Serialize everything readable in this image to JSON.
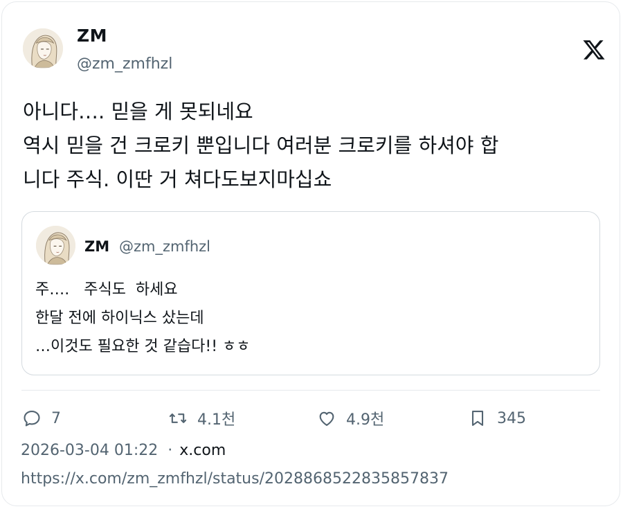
{
  "author": {
    "display_name": "ZM",
    "handle": "@zm_zmfhzl"
  },
  "tweet": {
    "lines": [
      "아니다…. 믿을 게 못되네요",
      "역시 믿을 건 크로키 뿐입니다 여러분 크로키를 하셔야 합",
      "니다 주식. 이딴 거 쳐다도보지마십쇼"
    ]
  },
  "quoted_tweet": {
    "display_name": "ZM",
    "handle": "@zm_zmfhzl",
    "lines": [
      "주….   주식도  하세요",
      "한달 전에 하이닉스 샀는데",
      "…이것도 필요한 것 같습다!! ㅎㅎ"
    ]
  },
  "actions": {
    "replies": "7",
    "reposts": "4.1천",
    "likes": "4.9천",
    "bookmarks": "345"
  },
  "meta": {
    "timestamp": "2026-03-04 01:22",
    "separator": "·",
    "source": "x.com",
    "url": "https://x.com/zm_zmfhzl/status/2028868522835857837"
  },
  "icons": {
    "brand": "x-logo-icon",
    "reply": "reply-bubble-icon",
    "repost": "repost-icon",
    "like": "heart-icon",
    "bookmark": "bookmark-icon"
  },
  "colors": {
    "text_primary": "#0f1419",
    "text_secondary": "#536471",
    "border": "#e6e9ec"
  }
}
